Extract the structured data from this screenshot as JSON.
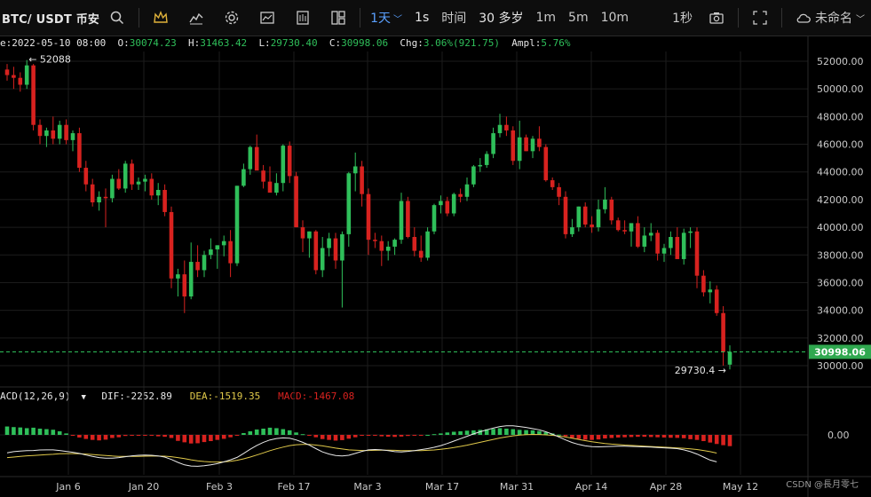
{
  "toolbar": {
    "symbol": "BTC/ USDT 币安",
    "interval_active": "1天",
    "items": [
      "1s",
      "时间",
      "30 多岁",
      "1m",
      "5m",
      "10m"
    ],
    "right_interval": "1秒",
    "layout_name": "未命名"
  },
  "ohlc": {
    "date": "e:2022-05-10 08:00",
    "open_label": "O:",
    "open": "30074.23",
    "high_label": "H:",
    "high": "31463.42",
    "low_label": "L:",
    "low": "29730.40",
    "close_label": "C:",
    "close": "30998.06",
    "chg_label": "Chg:",
    "chg": "3.06%(921.75)",
    "ampl_label": "Ampl:",
    "ampl": "5.76%"
  },
  "macd_legend": {
    "name": "ACD(12,26,9)",
    "dif": "DIF:-2252.89",
    "dea": "DEA:-1519.35",
    "macd": "MACD:-1467.08"
  },
  "colors": {
    "up": "#2fbf5a",
    "down": "#d8221f",
    "dif": "#e8e8e8",
    "dea": "#e0c94a",
    "price_tag": "#2fa84f"
  },
  "chart_data": {
    "type": "candlestick",
    "price_axis": {
      "min": 30000,
      "max": 52000,
      "ticks": [
        30000,
        32000,
        34000,
        36000,
        38000,
        40000,
        42000,
        44000,
        46000,
        48000,
        50000,
        52000
      ]
    },
    "macd_axis_tick": "0.00",
    "x_labels": [
      "Jan 6",
      "Jan 20",
      "Feb 3",
      "Feb 17",
      "Mar 3",
      "Mar 17",
      "Mar 31",
      "Apr 14",
      "Apr 28",
      "May 12"
    ],
    "current_price": 30998.06,
    "high_marker": 52088,
    "low_marker": 29730.4,
    "candles": [
      [
        51400,
        51800,
        50600,
        51000
      ],
      [
        51000,
        51600,
        50000,
        50800
      ],
      [
        50800,
        51200,
        49800,
        50300
      ],
      [
        50300,
        52088,
        50000,
        51700
      ],
      [
        51700,
        51800,
        47000,
        47400
      ],
      [
        47400,
        47800,
        46000,
        46600
      ],
      [
        46600,
        47200,
        45800,
        47000
      ],
      [
        47000,
        48000,
        46000,
        46400
      ],
      [
        46400,
        47700,
        46000,
        47400
      ],
      [
        47400,
        47800,
        46000,
        46300
      ],
      [
        46300,
        47000,
        45500,
        46800
      ],
      [
        46800,
        47200,
        44000,
        44300
      ],
      [
        44300,
        44800,
        42600,
        43100
      ],
      [
        43100,
        43500,
        41500,
        41800
      ],
      [
        41800,
        42600,
        41200,
        42200
      ],
      [
        42200,
        42800,
        40000,
        42100
      ],
      [
        42100,
        43800,
        41800,
        43500
      ],
      [
        43500,
        44200,
        42700,
        42800
      ],
      [
        42800,
        44800,
        42500,
        44600
      ],
      [
        44600,
        44900,
        42700,
        43100
      ],
      [
        43100,
        43600,
        42700,
        43300
      ],
      [
        43300,
        43800,
        42600,
        43500
      ],
      [
        43500,
        43900,
        42000,
        42300
      ],
      [
        42300,
        43200,
        41600,
        42700
      ],
      [
        42700,
        43100,
        40800,
        41100
      ],
      [
        41100,
        41500,
        35600,
        36300
      ],
      [
        36300,
        37000,
        35000,
        36600
      ],
      [
        36600,
        37600,
        33800,
        35000
      ],
      [
        35000,
        38900,
        34800,
        37500
      ],
      [
        37500,
        38700,
        36400,
        36900
      ],
      [
        36900,
        38300,
        36400,
        38000
      ],
      [
        38000,
        39200,
        37700,
        38400
      ],
      [
        38400,
        38700,
        37000,
        38700
      ],
      [
        38700,
        39400,
        37900,
        39000
      ],
      [
        39000,
        39800,
        36400,
        37400
      ],
      [
        37400,
        43000,
        37200,
        43000
      ],
      [
        43000,
        44600,
        42900,
        44200
      ],
      [
        44200,
        45900,
        43800,
        45800
      ],
      [
        45800,
        46700,
        44200,
        44100
      ],
      [
        44100,
        44500,
        42800,
        43300
      ],
      [
        43300,
        44400,
        42900,
        42500
      ],
      [
        42500,
        43900,
        42300,
        43200
      ],
      [
        43200,
        46000,
        42600,
        45900
      ],
      [
        45900,
        46200,
        43200,
        43700
      ],
      [
        43700,
        44000,
        40000,
        40000
      ],
      [
        40000,
        40500,
        38200,
        39200
      ],
      [
        39200,
        39700,
        37800,
        39700
      ],
      [
        39700,
        39800,
        36600,
        36900
      ],
      [
        36900,
        39300,
        36400,
        38500
      ],
      [
        38500,
        39600,
        37900,
        39200
      ],
      [
        39200,
        39600,
        37000,
        37600
      ],
      [
        37600,
        39700,
        34200,
        39500
      ],
      [
        39500,
        44000,
        38600,
        43900
      ],
      [
        43900,
        45400,
        42600,
        44400
      ],
      [
        44400,
        44800,
        41500,
        42400
      ],
      [
        42400,
        42800,
        38000,
        39100
      ],
      [
        39100,
        39600,
        38500,
        39000
      ],
      [
        39000,
        39400,
        37200,
        38300
      ],
      [
        38300,
        39000,
        37600,
        38600
      ],
      [
        38600,
        39200,
        38000,
        39100
      ],
      [
        39100,
        42500,
        38800,
        41900
      ],
      [
        41900,
        42200,
        39200,
        39300
      ],
      [
        39300,
        40000,
        37900,
        38300
      ],
      [
        38300,
        39400,
        37500,
        37800
      ],
      [
        37800,
        40000,
        37600,
        39700
      ],
      [
        39700,
        41700,
        39500,
        41600
      ],
      [
        41600,
        42300,
        41000,
        41900
      ],
      [
        41900,
        42200,
        40800,
        41000
      ],
      [
        41000,
        42500,
        40800,
        42400
      ],
      [
        42400,
        42800,
        41800,
        42200
      ],
      [
        42200,
        43600,
        41900,
        43100
      ],
      [
        43100,
        44500,
        42900,
        44400
      ],
      [
        44400,
        45000,
        44000,
        44500
      ],
      [
        44500,
        45500,
        44300,
        45300
      ],
      [
        45300,
        47200,
        45000,
        46800
      ],
      [
        46800,
        48200,
        46500,
        47400
      ],
      [
        47400,
        48000,
        46600,
        47000
      ],
      [
        47000,
        47300,
        44500,
        44800
      ],
      [
        44800,
        47700,
        44200,
        46500
      ],
      [
        46500,
        46700,
        45500,
        45500
      ],
      [
        45500,
        46600,
        45000,
        46400
      ],
      [
        46400,
        47300,
        45500,
        45800
      ],
      [
        45800,
        46000,
        43300,
        43400
      ],
      [
        43400,
        43600,
        42700,
        42900
      ],
      [
        42900,
        43200,
        41600,
        42200
      ],
      [
        42200,
        42600,
        39200,
        39500
      ],
      [
        39500,
        40600,
        39300,
        40000
      ],
      [
        40000,
        41500,
        39700,
        41500
      ],
      [
        41500,
        41800,
        40000,
        40200
      ],
      [
        40200,
        40800,
        39600,
        40000
      ],
      [
        40000,
        42000,
        39700,
        41300
      ],
      [
        41300,
        42900,
        41000,
        42000
      ],
      [
        42000,
        42200,
        40200,
        40500
      ],
      [
        40500,
        40700,
        39700,
        39800
      ],
      [
        39800,
        40500,
        39500,
        39700
      ],
      [
        39700,
        40200,
        38600,
        40300
      ],
      [
        40300,
        40800,
        38500,
        38600
      ],
      [
        38600,
        40000,
        38200,
        39400
      ],
      [
        39400,
        40300,
        39000,
        39600
      ],
      [
        39600,
        39800,
        37600,
        38100
      ],
      [
        38100,
        38800,
        37500,
        38500
      ],
      [
        38500,
        39700,
        38000,
        39300
      ],
      [
        39300,
        40000,
        37700,
        37700
      ],
      [
        37700,
        39900,
        37300,
        39600
      ],
      [
        39600,
        40000,
        38500,
        39700
      ],
      [
        39700,
        40000,
        35600,
        36500
      ],
      [
        36500,
        36900,
        35000,
        35300
      ],
      [
        35300,
        36100,
        34500,
        35500
      ],
      [
        35500,
        35800,
        33600,
        33800
      ],
      [
        33800,
        34300,
        30000,
        31000
      ],
      [
        30074.23,
        31463.42,
        29730.4,
        30998.06
      ]
    ],
    "macd_hist": [
      700,
      650,
      620,
      560,
      600,
      520,
      480,
      430,
      300,
      120,
      -80,
      -220,
      -340,
      -420,
      -460,
      -400,
      -260,
      -200,
      -90,
      -60,
      -50,
      -40,
      -70,
      -120,
      -160,
      -260,
      -500,
      -620,
      -720,
      -700,
      -600,
      -520,
      -420,
      -330,
      -200,
      -40,
      150,
      300,
      450,
      520,
      600,
      560,
      480,
      380,
      200,
      60,
      -40,
      -200,
      -350,
      -420,
      -480,
      -440,
      -320,
      -200,
      -80,
      -30,
      -60,
      -120,
      -150,
      -170,
      -140,
      -90,
      -60,
      -20,
      0,
      60,
      120,
      200,
      260,
      300,
      350,
      380,
      420,
      460,
      500,
      560,
      520,
      480,
      420,
      400,
      380,
      320,
      220,
      120,
      20,
      -120,
      -250,
      -340,
      -400,
      -420,
      -380,
      -300,
      -260,
      -220,
      -200,
      -180,
      -160,
      -160,
      -180,
      -200,
      -220,
      -240,
      -250,
      -280,
      -360,
      -420,
      -520,
      -640,
      -760,
      -860,
      -940
    ],
    "dif": [
      -1500,
      -1400,
      -1350,
      -1320,
      -1300,
      -1260,
      -1250,
      -1250,
      -1300,
      -1380,
      -1450,
      -1550,
      -1680,
      -1800,
      -1900,
      -1950,
      -1950,
      -1900,
      -1820,
      -1750,
      -1700,
      -1680,
      -1700,
      -1760,
      -1850,
      -2050,
      -2300,
      -2500,
      -2600,
      -2620,
      -2580,
      -2500,
      -2400,
      -2250,
      -2080,
      -1880,
      -1550,
      -1200,
      -880,
      -620,
      -420,
      -300,
      -250,
      -280,
      -420,
      -620,
      -860,
      -1150,
      -1420,
      -1600,
      -1720,
      -1760,
      -1700,
      -1550,
      -1380,
      -1250,
      -1220,
      -1250,
      -1320,
      -1400,
      -1420,
      -1380,
      -1320,
      -1230,
      -1150,
      -1040,
      -900,
      -720,
      -520,
      -320,
      -120,
      80,
      260,
      420,
      560,
      700,
      760,
      760,
      700,
      620,
      520,
      420,
      260,
      60,
      -180,
      -420,
      -640,
      -800,
      -920,
      -980,
      -1000,
      -980,
      -960,
      -950,
      -950,
      -960,
      -980,
      -1000,
      -1020,
      -1050,
      -1080,
      -1110,
      -1150,
      -1250,
      -1400,
      -1600,
      -1850,
      -2100,
      -2252.89
    ],
    "dea": [
      -1900,
      -1850,
      -1800,
      -1750,
      -1720,
      -1680,
      -1650,
      -1620,
      -1580,
      -1560,
      -1560,
      -1570,
      -1600,
      -1640,
      -1680,
      -1720,
      -1760,
      -1790,
      -1800,
      -1800,
      -1790,
      -1780,
      -1770,
      -1770,
      -1780,
      -1820,
      -1900,
      -1980,
      -2080,
      -2160,
      -2220,
      -2260,
      -2270,
      -2250,
      -2200,
      -2120,
      -2000,
      -1850,
      -1680,
      -1500,
      -1320,
      -1160,
      -1020,
      -900,
      -820,
      -790,
      -800,
      -850,
      -920,
      -1010,
      -1100,
      -1180,
      -1250,
      -1280,
      -1300,
      -1300,
      -1290,
      -1280,
      -1280,
      -1290,
      -1310,
      -1320,
      -1320,
      -1310,
      -1290,
      -1260,
      -1200,
      -1140,
      -1060,
      -960,
      -860,
      -740,
      -620,
      -500,
      -380,
      -260,
      -160,
      -80,
      -20,
      20,
      40,
      30,
      0,
      -40,
      -100,
      -180,
      -280,
      -380,
      -480,
      -570,
      -650,
      -720,
      -770,
      -810,
      -850,
      -880,
      -910,
      -940,
      -970,
      -1000,
      -1030,
      -1060,
      -1090,
      -1120,
      -1160,
      -1220,
      -1300,
      -1400,
      -1519.35
    ]
  },
  "watermark": "CSDN @長月零七"
}
